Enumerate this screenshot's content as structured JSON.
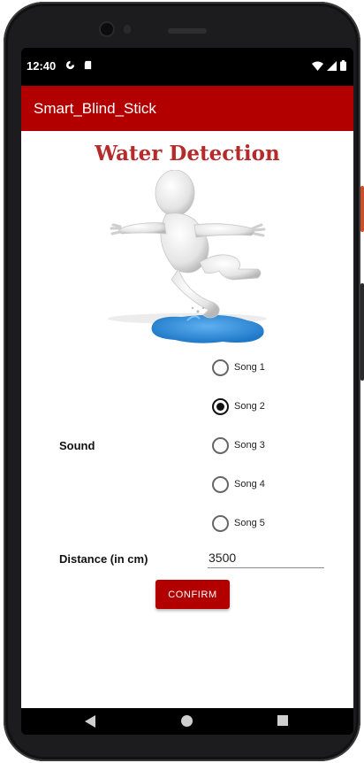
{
  "status_bar": {
    "time": "12:40",
    "left_icons": [
      "data-saver-icon",
      "sd-card-icon"
    ],
    "right_icons": [
      "wifi-icon",
      "cellular-signal-icon",
      "battery-icon"
    ]
  },
  "app_bar": {
    "title": "Smart_Blind_Stick",
    "color": "#b20000"
  },
  "page": {
    "heading": "Water Detection",
    "heading_color": "#b52a2a",
    "illustration": "figure-slipping-on-water-puddle"
  },
  "sound": {
    "label": "Sound",
    "options": [
      {
        "label": "Song 1",
        "checked": false
      },
      {
        "label": "Song 2",
        "checked": true
      },
      {
        "label": "Song 3",
        "checked": false
      },
      {
        "label": "Song 4",
        "checked": false
      },
      {
        "label": "Song 5",
        "checked": false
      }
    ]
  },
  "distance": {
    "label": "Distance (in cm)",
    "value": "3500"
  },
  "confirm_button": {
    "label": "CONFIRM",
    "color": "#b20000"
  },
  "nav_bar": {
    "icons": [
      "back-icon",
      "home-icon",
      "recents-icon"
    ]
  }
}
